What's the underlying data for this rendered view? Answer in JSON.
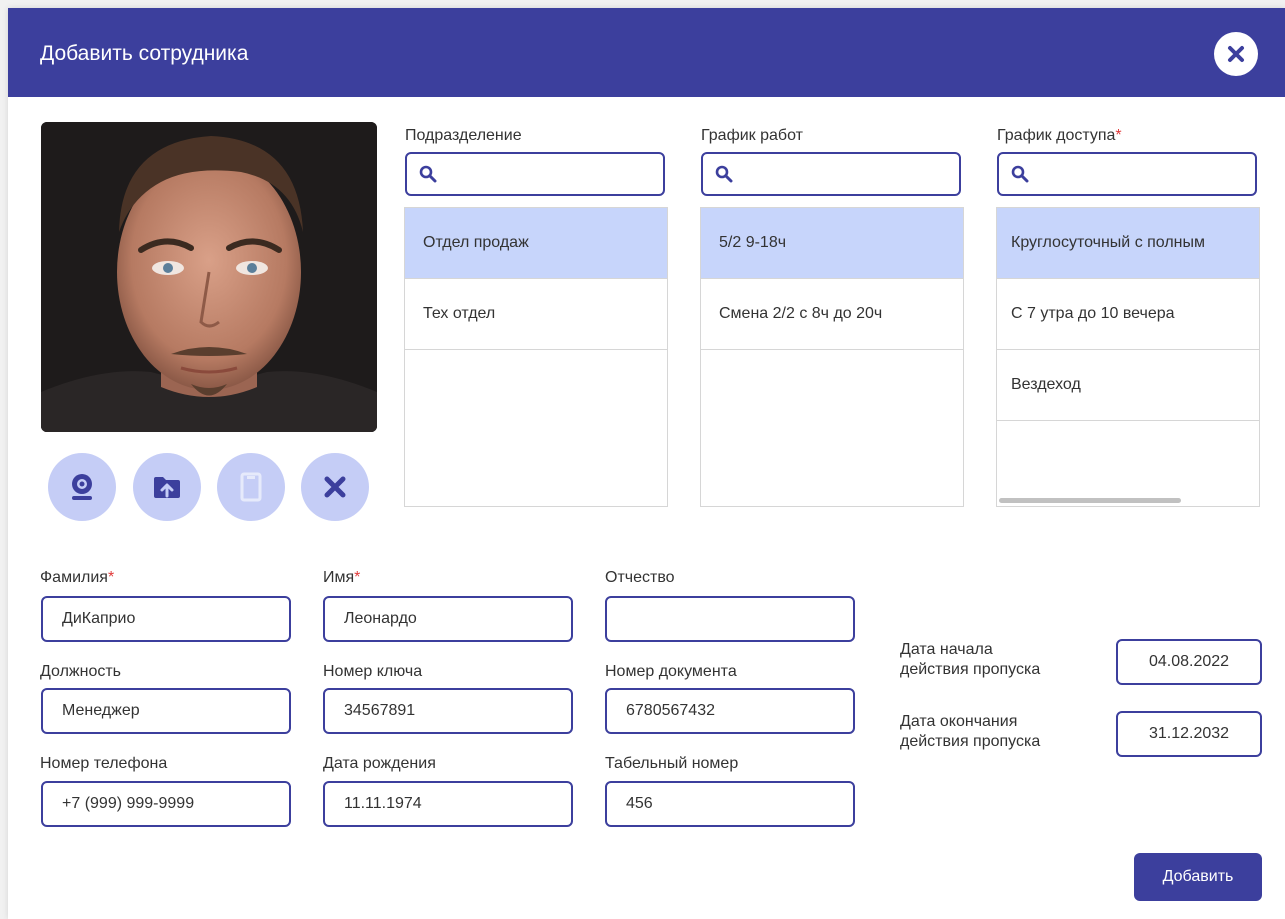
{
  "dialog": {
    "title": "Добавить сотрудника",
    "close_icon": "close-circle-icon",
    "submit_label": "Добавить"
  },
  "photo": {
    "alt": "employee-photo",
    "buttons": [
      {
        "name": "webcam-button",
        "icon": "webcam-icon"
      },
      {
        "name": "upload-folder-button",
        "icon": "folder-upload-icon"
      },
      {
        "name": "card-button",
        "icon": "card-icon",
        "disabled": true
      },
      {
        "name": "remove-photo-button",
        "icon": "close-icon"
      }
    ]
  },
  "lists": {
    "department": {
      "label": "Подразделение",
      "required": false,
      "search_value": "",
      "items": [
        "Отдел продаж",
        "Тех отдел"
      ],
      "selected_index": 0
    },
    "work_schedule": {
      "label": "График работ",
      "required": false,
      "search_value": "",
      "items": [
        "5/2 9-18ч",
        "Смена 2/2 с 8ч до 20ч"
      ],
      "selected_index": 0
    },
    "access_schedule": {
      "label": "График доступа",
      "required": true,
      "search_value": "",
      "items": [
        "Круглосуточный с полным",
        "С 7 утра до 10 вечера",
        "Вездеход"
      ],
      "selected_index": 0
    }
  },
  "required_mark": "*",
  "form": {
    "last_name": {
      "label": "Фамилия",
      "required": true,
      "value": "ДиКаприо"
    },
    "first_name": {
      "label": "Имя",
      "required": true,
      "value": "Леонардо"
    },
    "middle_name": {
      "label": "Отчество",
      "required": false,
      "value": ""
    },
    "position": {
      "label": "Должность",
      "value": "Менеджер"
    },
    "key_number": {
      "label": "Номер ключа",
      "value": "34567891"
    },
    "document_number": {
      "label": "Номер документа",
      "value": "6780567432"
    },
    "phone": {
      "label": "Номер телефона",
      "value": "+7 (999) 999-9999"
    },
    "birth_date": {
      "label": "Дата рождения",
      "value": "11.11.1974"
    },
    "tab_number": {
      "label": "Табельный номер",
      "value": "456"
    }
  },
  "pass": {
    "start_label_line1": "Дата начала",
    "start_label_line2": "действия пропуска",
    "start_value": "04.08.2022",
    "end_label_line1": "Дата окончания",
    "end_label_line2": "действия пропуска",
    "end_value": "31.12.2032"
  },
  "colors": {
    "primary": "#3c3f9d",
    "selected_row": "#c7d5fb",
    "icon_button_bg": "#c5cdf6",
    "required": "#e03a3a"
  }
}
